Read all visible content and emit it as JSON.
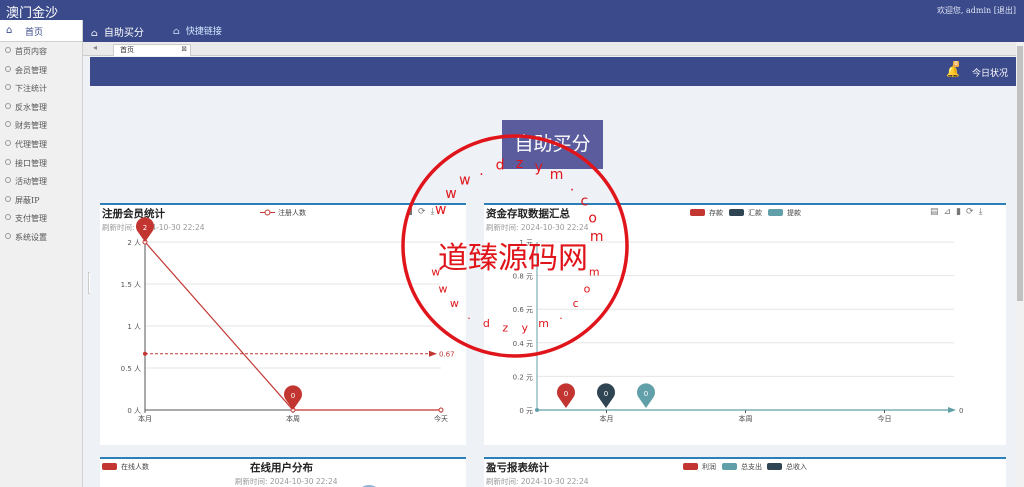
{
  "app": {
    "title": "澳门金沙",
    "welcome": "欢迎您, admin [退出]"
  },
  "sidebar": {
    "home_label": "首页",
    "items": [
      {
        "label": "首页内容"
      },
      {
        "label": "会员管理"
      },
      {
        "label": "下注统计"
      },
      {
        "label": "反水管理"
      },
      {
        "label": "财务管理"
      },
      {
        "label": "代理管理"
      },
      {
        "label": "接口管理"
      },
      {
        "label": "活动管理"
      },
      {
        "label": "屏蔽IP"
      },
      {
        "label": "支付管理"
      },
      {
        "label": "系统设置"
      }
    ]
  },
  "navbar": {
    "auto_bonus": "自助买分",
    "quick_links": "快捷链接"
  },
  "tabs": {
    "active_tab": "首页"
  },
  "header": {
    "badge_count": "0",
    "status_label": "今日状况"
  },
  "main": {
    "big_button": "自助买分"
  },
  "watermark": {
    "text": "道臻源码网",
    "url": "www.dzym.com"
  },
  "panels": {
    "register": {
      "title": "注册会员统计",
      "refresh": "刷新时间: 2024-10-30 22:24",
      "legend": "注册人数",
      "avg_label": "0.67",
      "pin_max": "2",
      "pin_min": "0"
    },
    "funds": {
      "title": "资金存取数据汇总",
      "refresh": "刷新时间: 2024-10-30 22:24",
      "legend": [
        "存款",
        "汇款",
        "提款"
      ],
      "axis_end": "0",
      "pins": [
        "0",
        "0",
        "0"
      ]
    },
    "online": {
      "title": "在线用户分布",
      "refresh": "刷新时间: 2024-10-30 22:24",
      "legend": "在线人数"
    },
    "profit": {
      "title": "盈亏报表统计",
      "refresh": "刷新时间: 2024-10-30 22:24",
      "legend": [
        "利润",
        "总支出",
        "总收入"
      ]
    }
  },
  "colors": {
    "nav": "#3b4a8a",
    "red": "#c23531",
    "navy": "#2f4554",
    "teal": "#61a0a8"
  },
  "chart_data": [
    {
      "type": "line",
      "title": "注册会员统计",
      "categories": [
        "本月",
        "本周",
        "今天"
      ],
      "series": [
        {
          "name": "注册人数",
          "values": [
            2,
            0,
            0
          ]
        }
      ],
      "ylim": [
        0,
        2
      ],
      "yticks": [
        "0 人",
        "0.5 人",
        "1 人",
        "1.5 人",
        "2 人"
      ],
      "mark_line": {
        "type": "average",
        "value": 0.67
      },
      "mark_points": [
        "max",
        "min"
      ]
    },
    {
      "type": "line",
      "title": "资金存取数据汇总",
      "categories": [
        "本月",
        "本周",
        "今日"
      ],
      "series": [
        {
          "name": "存款",
          "values": [
            0,
            0,
            0
          ]
        },
        {
          "name": "汇款",
          "values": [
            0,
            0,
            0
          ]
        },
        {
          "name": "提款",
          "values": [
            0,
            0,
            0
          ]
        }
      ],
      "ylim": [
        0,
        1
      ],
      "yticks": [
        "0 元",
        "0.2 元",
        "0.4 元",
        "0.6 元",
        "0.8 元",
        "1 元"
      ]
    }
  ]
}
